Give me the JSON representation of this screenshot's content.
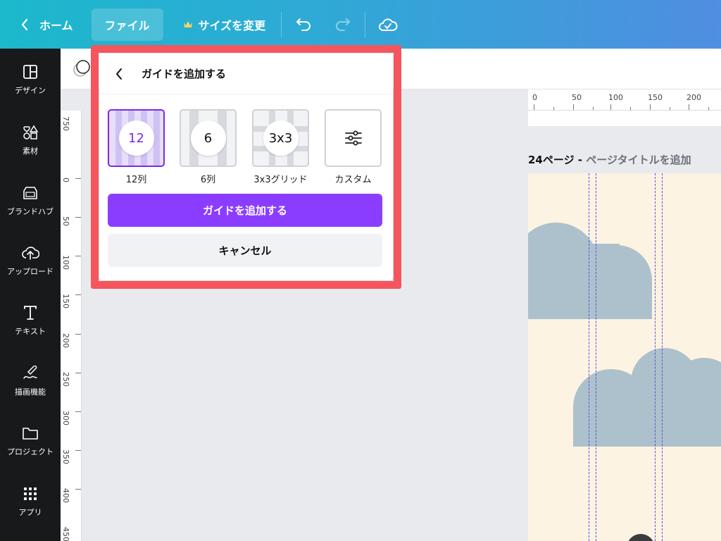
{
  "topbar": {
    "home_label": "ホーム",
    "file_label": "ファイル",
    "resize_label": "サイズを変更"
  },
  "sidebar": {
    "items": [
      {
        "label": "デザイン",
        "icon": "layout-icon"
      },
      {
        "label": "素材",
        "icon": "elements-icon"
      },
      {
        "label": "ブランドハブ",
        "icon": "brand-hub-icon"
      },
      {
        "label": "アップロード",
        "icon": "upload-cloud-icon"
      },
      {
        "label": "テキスト",
        "icon": "text-icon"
      },
      {
        "label": "描画機能",
        "icon": "draw-icon"
      },
      {
        "label": "プロジェクト",
        "icon": "folder-icon"
      },
      {
        "label": "アプリ",
        "icon": "apps-grid-icon"
      }
    ]
  },
  "ruler": {
    "top_ticks": [
      "0",
      "50",
      "100",
      "150",
      "200"
    ],
    "left_ticks": [
      "750",
      "0",
      "50",
      "100",
      "150",
      "200",
      "250",
      "300",
      "350",
      "400",
      "450"
    ]
  },
  "canvas": {
    "page_number": "24ページ - ",
    "title_placeholder": "ページタイトルを追加",
    "page_bg": "#fdf3e2",
    "cloud_color": "#acc1cb"
  },
  "guides_popover": {
    "title": "ガイドを追加する",
    "options": [
      {
        "badge": "12",
        "label": "12列",
        "selected": true
      },
      {
        "badge": "6",
        "label": "6列",
        "selected": false
      },
      {
        "badge": "3x3",
        "label": "3x3グリッド",
        "selected": false
      },
      {
        "badge": "",
        "label": "カスタム",
        "selected": false,
        "icon": "sliders-icon"
      }
    ],
    "add_button": "ガイドを追加する",
    "cancel_button": "キャンセル"
  },
  "colors": {
    "accent": "#8b3dff",
    "highlight_border": "#f5555d",
    "topbar_start": "#1cb8cc",
    "topbar_end": "#4f8ee0"
  }
}
